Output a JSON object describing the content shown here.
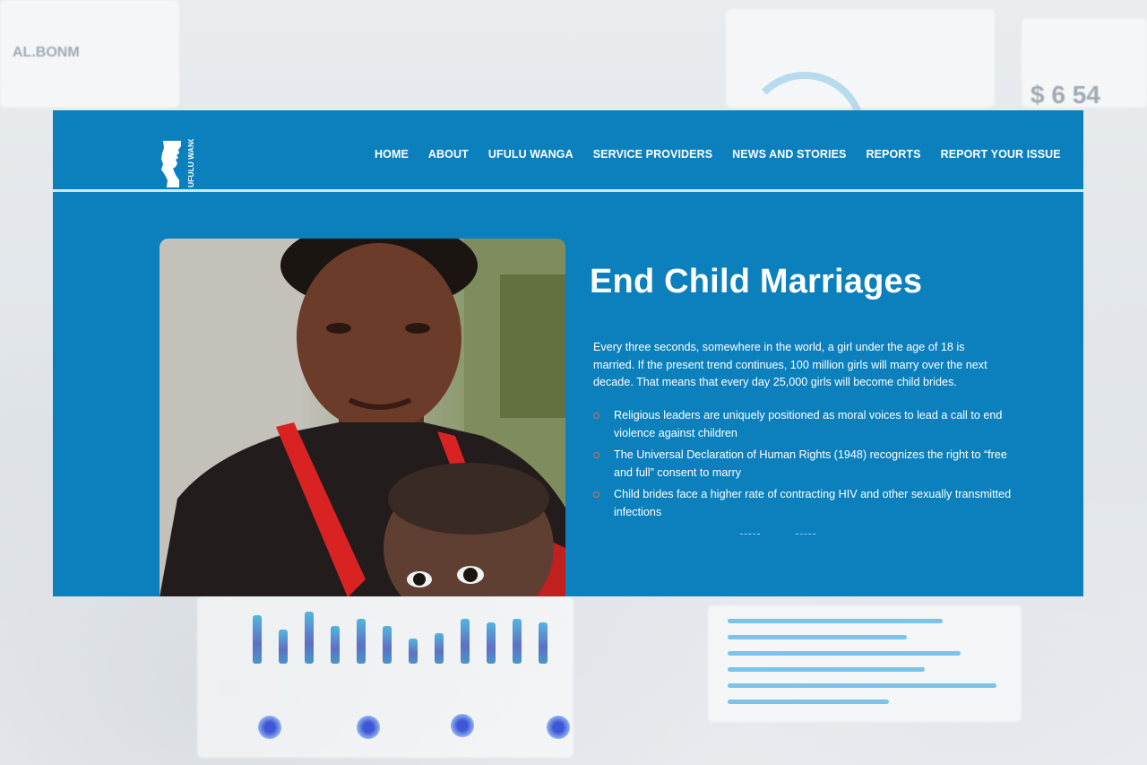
{
  "site": {
    "logo_text": "UFULU WANGA",
    "nav": [
      "HOME",
      "ABOUT",
      "UFULU WANGA",
      "SERVICE PROVIDERS",
      "NEWS AND STORIES",
      "REPORTS",
      "REPORT YOUR ISSUE"
    ],
    "headline": "End Child Marriages",
    "intro": "Every three seconds, somewhere in the world, a girl under the age of 18 is married. If the present trend continues, 100 million girls will marry over the next decade. That means that every day 25,000 girls will become child brides.",
    "facts": [
      "Religious leaders are uniquely positioned as moral voices to lead a call to end violence against children",
      "The Universal Declaration of Human Rights (1948) recognizes the right to “free and full” consent to marry",
      "Child brides face a higher rate of contracting HIV and other sexually transmitted infections"
    ]
  },
  "colors": {
    "brand_blue": "#0b80bd",
    "bullet": "#e86a4e",
    "text": "#ffffff"
  }
}
